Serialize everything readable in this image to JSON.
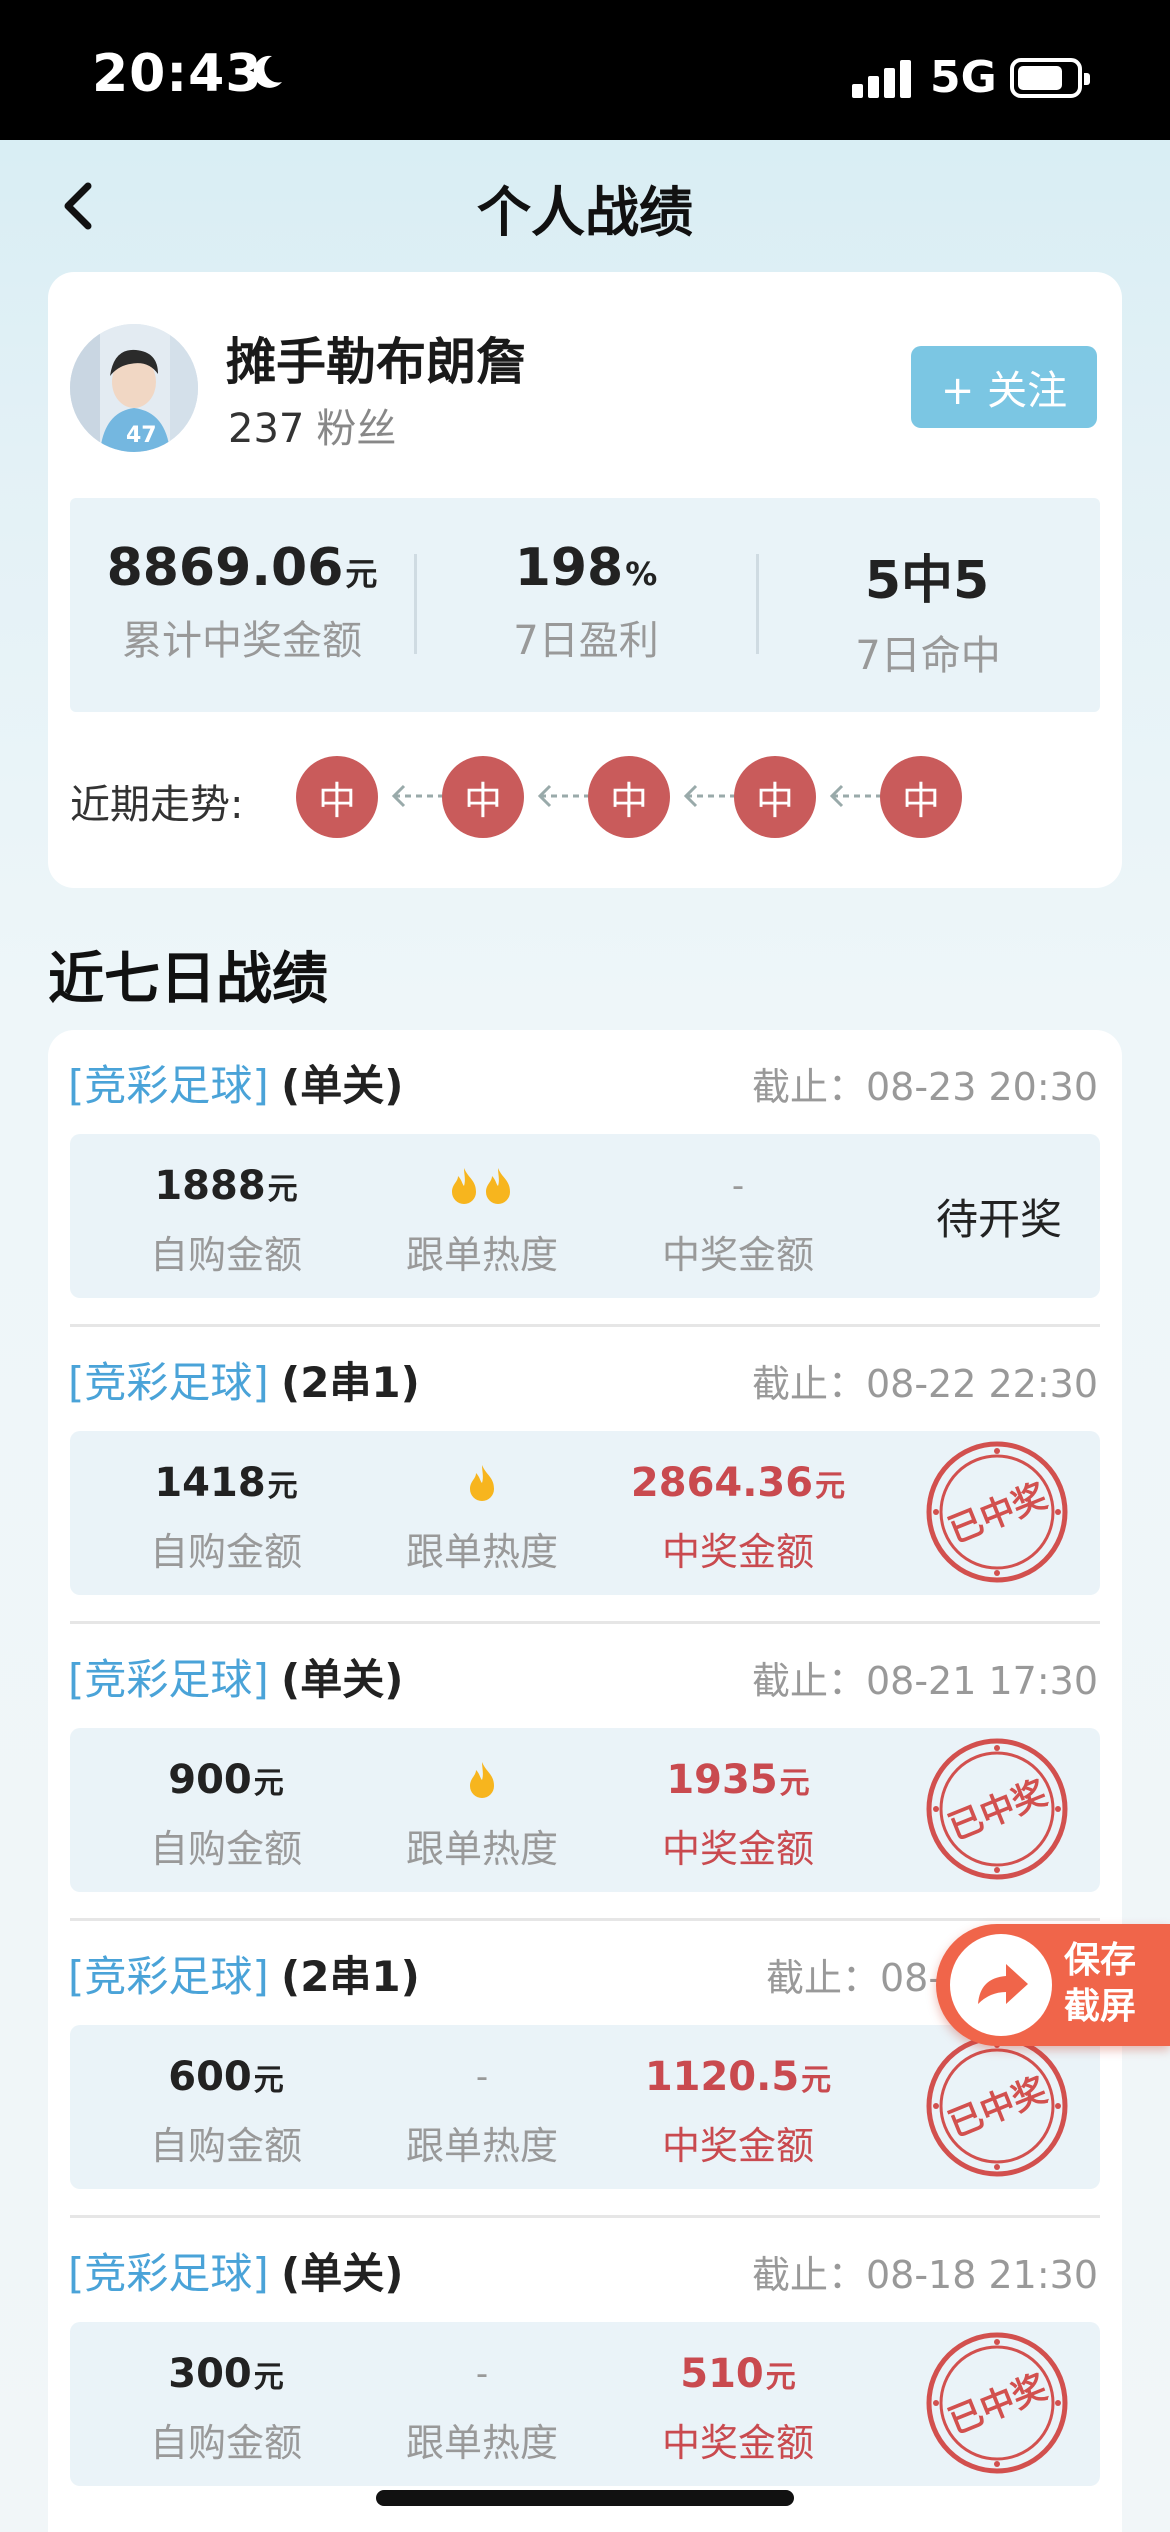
{
  "status_bar": {
    "time": "20:43",
    "network": "5G"
  },
  "header": {
    "title": "个人战绩"
  },
  "profile": {
    "name": "摊手勒布朗詹",
    "fans_count": "237",
    "fans_label": "粉丝",
    "follow_label": "+ 关注",
    "stats": [
      {
        "value": "8869.06",
        "unit": "元",
        "label": "累计中奖金额"
      },
      {
        "value": "198",
        "unit": "%",
        "label": "7日盈利"
      },
      {
        "value": "5中5",
        "unit": "",
        "label": "7日命中"
      }
    ],
    "trend_label": "近期走势:",
    "trend": [
      "中",
      "中",
      "中",
      "中",
      "中"
    ]
  },
  "section_title": "近七日战绩",
  "records": [
    {
      "type": "[竞彩足球]",
      "mode": "(单关)",
      "deadline": "截止：08-23 20:30",
      "buy_amount": "1888",
      "buy_unit": "元",
      "buy_label": "自购金额",
      "heat_label": "跟单热度",
      "heat_level": 2,
      "win_amount": "-",
      "win_unit": "",
      "win_label": "中奖金额",
      "status": "待开奖",
      "won": false
    },
    {
      "type": "[竞彩足球]",
      "mode": "(2串1)",
      "deadline": "截止：08-22 22:30",
      "buy_amount": "1418",
      "buy_unit": "元",
      "buy_label": "自购金额",
      "heat_label": "跟单热度",
      "heat_level": 1,
      "win_amount": "2864.36",
      "win_unit": "元",
      "win_label": "中奖金额",
      "status": "已中奖",
      "won": true
    },
    {
      "type": "[竞彩足球]",
      "mode": "(单关)",
      "deadline": "截止：08-21 17:30",
      "buy_amount": "900",
      "buy_unit": "元",
      "buy_label": "自购金额",
      "heat_label": "跟单热度",
      "heat_level": 1,
      "win_amount": "1935",
      "win_unit": "元",
      "win_label": "中奖金额",
      "status": "已中奖",
      "won": true
    },
    {
      "type": "[竞彩足球]",
      "mode": "(2串1)",
      "deadline": "截止：08-",
      "buy_amount": "600",
      "buy_unit": "元",
      "buy_label": "自购金额",
      "heat_label": "跟单热度",
      "heat_level": 0,
      "win_amount": "1120.5",
      "win_unit": "元",
      "win_label": "中奖金额",
      "status": "已中奖",
      "won": true
    },
    {
      "type": "[竞彩足球]",
      "mode": "(单关)",
      "deadline": "截止：08-18 21:30",
      "buy_amount": "300",
      "buy_unit": "元",
      "buy_label": "自购金额",
      "heat_label": "跟单热度",
      "heat_level": 0,
      "win_amount": "510",
      "win_unit": "元",
      "win_label": "中奖金额",
      "status": "已中奖",
      "won": true
    }
  ],
  "save_button": {
    "line1": "保存",
    "line2": "截屏"
  },
  "colors": {
    "accent_blue": "#4aa3d8",
    "win_red": "#c94a4f",
    "trend_red": "#c95b5b",
    "follow_blue": "#7bc6e3",
    "fab_orange": "#f0654a"
  }
}
